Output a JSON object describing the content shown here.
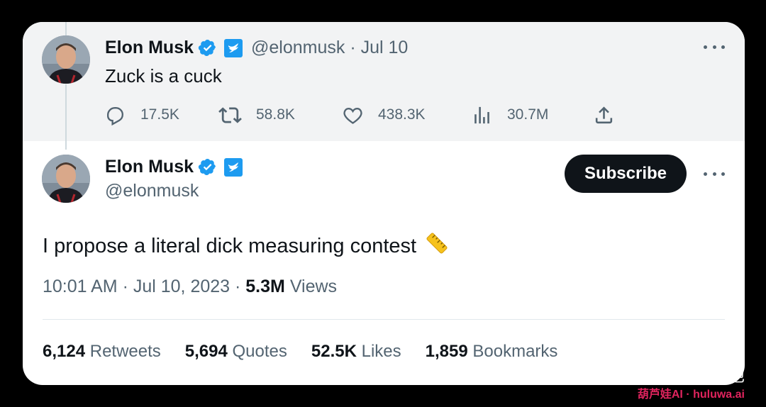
{
  "colors": {
    "accent": "#1d9bf0",
    "text_primary": "#0f1419",
    "text_secondary": "#536471",
    "background_parent": "#f2f3f4",
    "watermark_pink": "#e0245e"
  },
  "parent_tweet": {
    "author_name": "Elon Musk",
    "meta": "@elonmusk · Jul 10",
    "text": "Zuck is a cuck",
    "actions": {
      "replies": "17.5K",
      "retweets": "58.8K",
      "likes": "438.3K",
      "views": "30.7M"
    },
    "icons": [
      "reply-icon",
      "retweet-icon",
      "like-icon",
      "views-icon",
      "share-icon"
    ]
  },
  "main_tweet": {
    "author_name": "Elon Musk",
    "handle": "@elonmusk",
    "subscribe_label": "Subscribe",
    "text": "I propose a literal dick measuring contest",
    "emoji": "📏",
    "timestamp": "10:01 AM · Jul 10, 2023 · ",
    "views_count": "5.3M",
    "views_label": " Views",
    "stats": [
      {
        "count": "6,124",
        "label": "Retweets"
      },
      {
        "count": "5,694",
        "label": "Quotes"
      },
      {
        "count": "52.5K",
        "label": "Likes"
      },
      {
        "count": "1,859",
        "label": "Bookmarks"
      }
    ]
  },
  "watermark": {
    "text": "AI应用基地",
    "sub": "葫芦娃AI · huluwa.ai"
  }
}
